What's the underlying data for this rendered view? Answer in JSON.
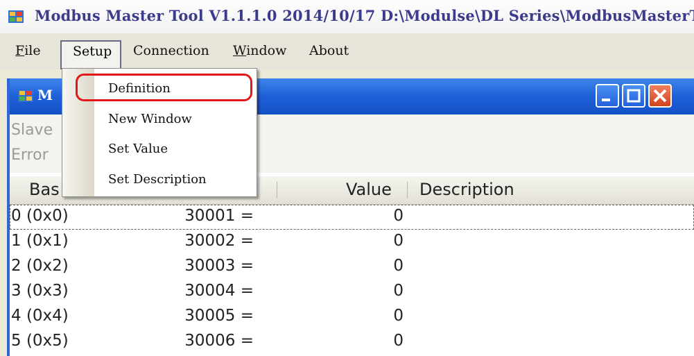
{
  "window": {
    "title": "Modbus Master Tool V1.1.1.0  2014/10/17  D:\\Modulse\\DL Series\\ModbusMasterToo"
  },
  "menubar": {
    "items": [
      {
        "label": "File",
        "accel": "F",
        "rest": "ile"
      },
      {
        "label": "Setup"
      },
      {
        "label": "Connection"
      },
      {
        "label": "Window",
        "accel": "W",
        "rest": "indow"
      },
      {
        "label": "About"
      }
    ]
  },
  "setup_menu": {
    "items": [
      "Definition",
      "New Window",
      "Set Value",
      "Set Description"
    ],
    "highlighted": "Definition"
  },
  "child_window": {
    "title_visible": "M",
    "info_lines": [
      "Slave",
      "Error"
    ]
  },
  "grid": {
    "headers": {
      "base": "Bas",
      "value": "Value",
      "description": "Description"
    },
    "rows": [
      {
        "base": "0 (0x0)",
        "address": "30001  =",
        "value": "0",
        "description": "",
        "selected": true
      },
      {
        "base": "1 (0x1)",
        "address": "30002  =",
        "value": "0",
        "description": ""
      },
      {
        "base": "2 (0x2)",
        "address": "30003  =",
        "value": "0",
        "description": ""
      },
      {
        "base": "3 (0x3)",
        "address": "30004  =",
        "value": "0",
        "description": ""
      },
      {
        "base": "4 (0x4)",
        "address": "30005  =",
        "value": "0",
        "description": ""
      },
      {
        "base": "5 (0x5)",
        "address": "30006  =",
        "value": "0",
        "description": ""
      }
    ]
  },
  "colors": {
    "child_title_bar": "#1e5fd6",
    "highlight": "#e01818",
    "title_text": "#3b3b8c"
  },
  "icons": [
    "app-icon",
    "minimize-icon",
    "maximize-icon",
    "close-icon"
  ]
}
